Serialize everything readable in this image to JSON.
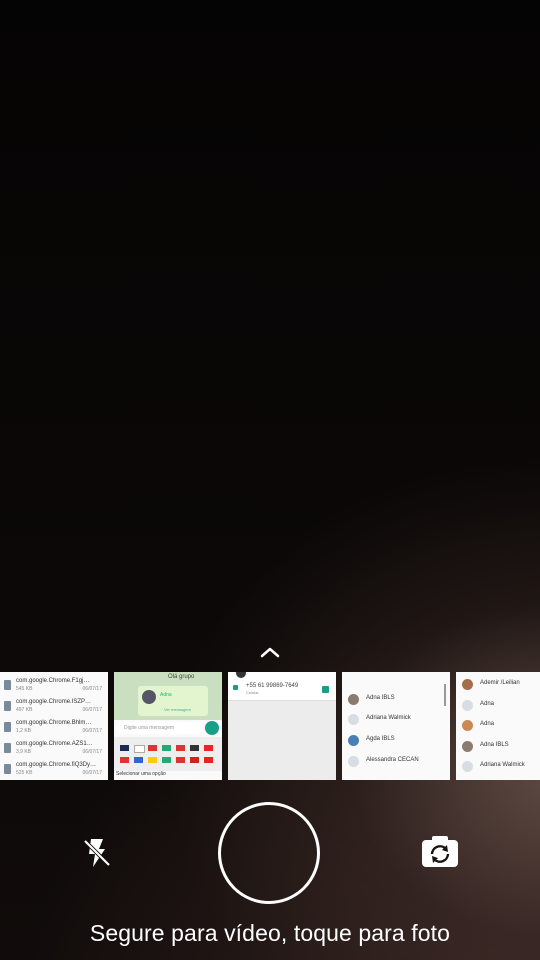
{
  "camera": {
    "hint_text": "Segure para vídeo, toque para foto",
    "flash_icon": "flash-off-icon",
    "shutter_icon": "shutter-button",
    "switch_icon": "switch-camera-icon",
    "expand_icon": "chevron-up-icon"
  },
  "gallery": {
    "thumb1": {
      "files": [
        {
          "name": "com.google.Chrome.F1gj…",
          "size": "545 KB",
          "date": "06/07/17"
        },
        {
          "name": "com.google.Chrome.ISZP…",
          "size": "497 KB",
          "date": "06/07/17"
        },
        {
          "name": "com.google.Chrome.Bhlm…",
          "size": "1,2 KB",
          "date": "06/07/17"
        },
        {
          "name": "com.google.Chrome.AZS1…",
          "size": "3,9 KB",
          "date": "06/07/17"
        },
        {
          "name": "com.google.Chrome.fiQ3Dy…",
          "size": "525 KB",
          "date": "06/07/17"
        }
      ]
    },
    "thumb2": {
      "title": "Olá grupo",
      "name": "Adna",
      "link": "Ver mensagem",
      "input_placeholder": "Digite uma mensagem",
      "bottom_text": "Selecionar uma opção"
    },
    "thumb3": {
      "number": "+55 61 99869-7649",
      "sub": "Celular"
    },
    "thumb4": {
      "contacts": [
        "Adna IBLS",
        "Adriana Walmick",
        "Agda IBLS",
        "Alessandra CECAN"
      ]
    },
    "thumb5": {
      "contacts": [
        "Ademir /Leilian",
        "Adna",
        "Adna",
        "Adna IBLS",
        "Adriana Walmick"
      ]
    }
  },
  "colors": {
    "accent": "#1a9e85",
    "hint_text": "#ffffff"
  }
}
